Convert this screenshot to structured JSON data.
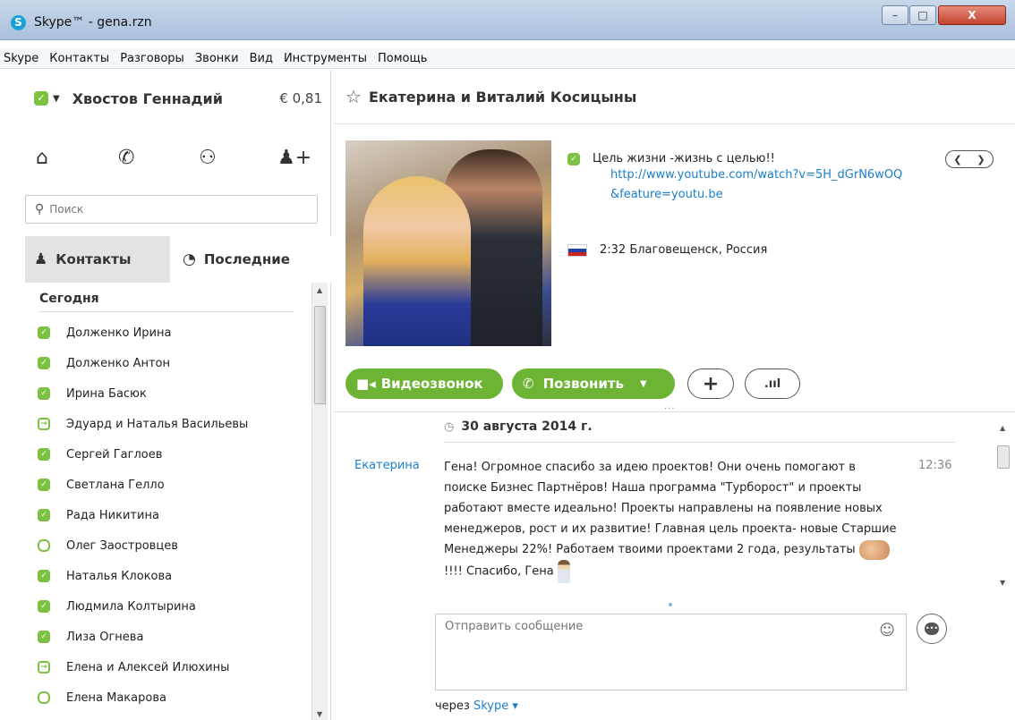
{
  "window": {
    "title": "Skype™ - gena.rzn",
    "min": "–",
    "max": "□",
    "close": "X"
  },
  "menu": [
    "Skype",
    "Контакты",
    "Разговоры",
    "Звонки",
    "Вид",
    "Инструменты",
    "Помощь"
  ],
  "profile": {
    "name": "Хвостов Геннадий",
    "credit": "€ 0,81"
  },
  "search": {
    "placeholder": "Поиск"
  },
  "tabs": {
    "contacts": "Контакты",
    "recent": "Последние"
  },
  "contact_list": {
    "section": "Сегодня",
    "items": [
      {
        "name": "Долженко Ирина",
        "status": "online"
      },
      {
        "name": "Долженко Антон",
        "status": "online"
      },
      {
        "name": "Ирина Басюк",
        "status": "online"
      },
      {
        "name": "Эдуард и Наталья Васильевы",
        "status": "mobile"
      },
      {
        "name": "Сергей Гаглоев",
        "status": "online"
      },
      {
        "name": "Светлана Гелло",
        "status": "online"
      },
      {
        "name": "Рада Никитина",
        "status": "online"
      },
      {
        "name": "Олег  Заостровцев",
        "status": "offline"
      },
      {
        "name": "Наталья Клокова",
        "status": "online"
      },
      {
        "name": "Людмила Колтырина",
        "status": "online"
      },
      {
        "name": "Лиза  Огнева",
        "status": "online"
      },
      {
        "name": "Елена и Алексей Илюхины",
        "status": "mobile"
      },
      {
        "name": "Елена  Макарова",
        "status": "offline"
      }
    ]
  },
  "conversation": {
    "title": "Екатерина и Виталий Косицыны",
    "mood": "Цель жизни -жизнь с целью!!",
    "link_line1": "http://www.youtube.com/watch?v=5H_dGrN6wOQ",
    "link_line2": "&feature=youtu.be",
    "location": "2:32 Благовещенск, Россия",
    "buttons": {
      "video": "Видеозвонок",
      "call": "Позвонить",
      "add": "+",
      "signal": ".ııl"
    }
  },
  "chat": {
    "date": "30 августа 2014 г.",
    "sender": "Екатерина",
    "time": "12:36",
    "message_part1": "Гена! Огромное спасибо за идею проектов! Они очень помогают в поиске Бизнес Партнёров! Наша программа \"Турборост\" и проекты работают вместе идеально! Проекты направлены на появление новых менеджеров, рост и их развитие! Главная цель проекта- новые Старшие Менеджеры 22%! Работаем твоими проектами 2 года, результаты",
    "message_part2": "!!!! Спасибо, Гена"
  },
  "compose": {
    "placeholder": "Отправить сообщение",
    "via_prefix": "через",
    "via_service": "Skype"
  },
  "colors": {
    "accent_green": "#6eb434",
    "link_blue": "#1b7fcc"
  }
}
